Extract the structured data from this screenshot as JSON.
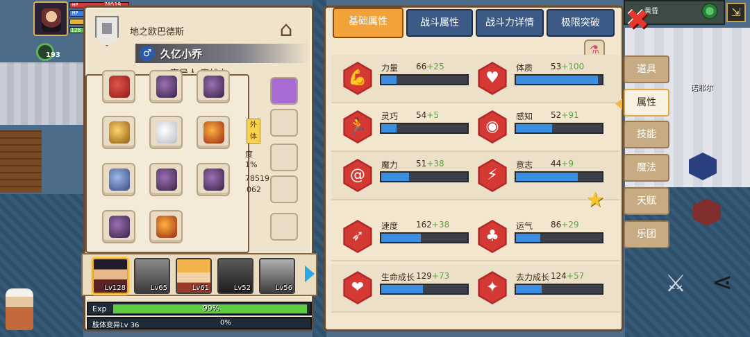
{
  "hud": {
    "hp_label": "HP",
    "hp_value": "78519",
    "mp_label": "MP",
    "exp_value": "128",
    "counter": "193"
  },
  "minimap": {
    "location": "黄昏"
  },
  "world": {
    "npc_name": "诺耶尔"
  },
  "character": {
    "title": "地之欧巴德斯",
    "name": "久亿小乔",
    "gender_symbol": "♂",
    "class_name": "变异人·魔战士"
  },
  "side_stats": {
    "label": "外体",
    "pct_label": "度",
    "pct_value": "1%",
    "num1": "78519",
    "num2": "062"
  },
  "party": [
    {
      "level": "Lv128",
      "active": true
    },
    {
      "level": "Lv65",
      "active": false
    },
    {
      "level": "Lv61",
      "active": false
    },
    {
      "level": "Lv52",
      "active": false
    },
    {
      "level": "Lv56",
      "active": false
    }
  ],
  "exp": {
    "label": "Exp",
    "percent_text": "99%",
    "fraction": 0.99
  },
  "limb": {
    "label": "肢体变异Lv 36",
    "percent_text": "0%"
  },
  "tabs": [
    {
      "label": "基础属性",
      "active": true
    },
    {
      "label": "战斗属性",
      "active": false
    },
    {
      "label": "战斗力详情",
      "active": false
    },
    {
      "label": "极限突破",
      "active": false
    }
  ],
  "attributes": [
    {
      "name": "力量",
      "base": "66",
      "bonus": "+25",
      "icon": "muscle-icon",
      "fill": 0.18
    },
    {
      "name": "体质",
      "base": "53",
      "bonus": "+100",
      "icon": "body-icon",
      "fill": 0.95
    },
    {
      "name": "灵巧",
      "base": "54",
      "bonus": "+5",
      "icon": "run-icon",
      "fill": 0.18
    },
    {
      "name": "感知",
      "base": "52",
      "bonus": "+91",
      "icon": "eye-icon",
      "fill": 0.42
    },
    {
      "name": "魔力",
      "base": "51",
      "bonus": "+38",
      "icon": "swirl-icon",
      "fill": 0.32
    },
    {
      "name": "意志",
      "base": "44",
      "bonus": "+9",
      "icon": "will-icon",
      "fill": 0.72
    },
    {
      "name": "速度",
      "base": "162",
      "bonus": "+38",
      "icon": "speed-icon",
      "fill": 0.46
    },
    {
      "name": "运气",
      "base": "86",
      "bonus": "+29",
      "icon": "clover-icon",
      "fill": 0.28
    },
    {
      "name": "生命成长",
      "base": "129",
      "bonus": "+73",
      "icon": "heart-icon",
      "fill": 0.48
    },
    {
      "name": "去力成长",
      "base": "124",
      "bonus": "+57",
      "icon": "growth-icon",
      "fill": 0.3
    }
  ],
  "side_nav": [
    {
      "label": "道具",
      "active": false
    },
    {
      "label": "属性",
      "active": true
    },
    {
      "label": "技能",
      "active": false
    },
    {
      "label": "魔法",
      "active": false
    },
    {
      "label": "天赋",
      "active": false
    },
    {
      "label": "乐团",
      "active": false
    }
  ],
  "close_symbol": "✖",
  "colors": {
    "accent_tab": "#f1a33a",
    "tab_blue": "#3b5a86",
    "bar_blue": "#3b8ee0",
    "exp_green": "#5fcb41",
    "bonus_green": "#58a83b",
    "attr_red": "#d43a33"
  }
}
